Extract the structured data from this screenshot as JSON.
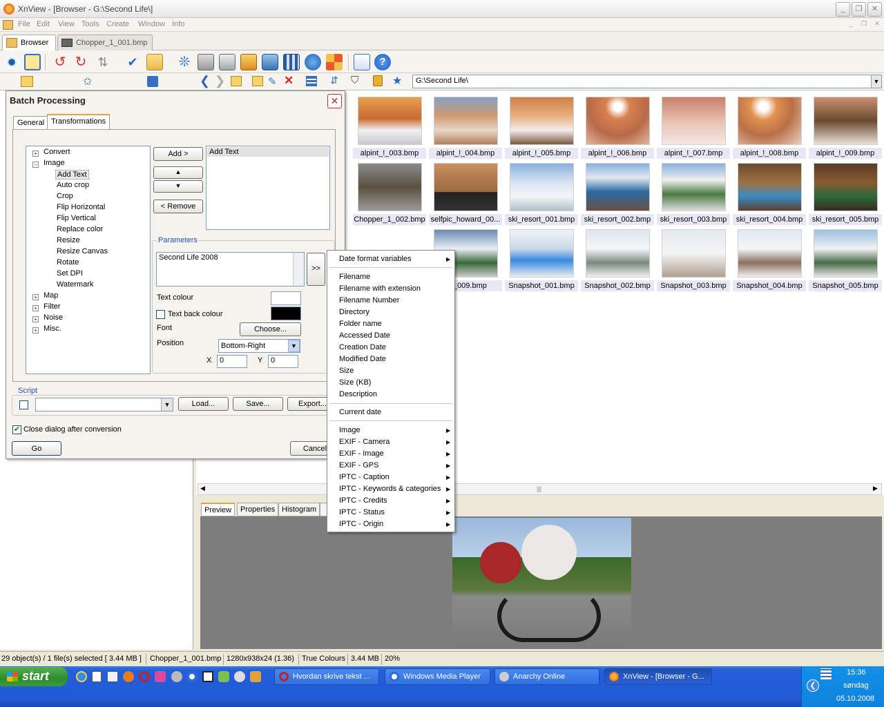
{
  "window": {
    "title": "XnView - [Browser - G:\\Second Life\\]"
  },
  "menu": [
    "File",
    "Edit",
    "View",
    "Tools",
    "Create",
    "Window",
    "Info"
  ],
  "tabs": {
    "browser": "Browser",
    "file": "Chopper_1_001.bmp"
  },
  "address": "G:\\Second Life\\",
  "thumbnails": [
    "alpint_!_003.bmp",
    "alpint_!_004.bmp",
    "alpint_!_005.bmp",
    "alpint_!_006.bmp",
    "alpint_!_007.bmp",
    "alpint_!_008.bmp",
    "alpint_!_009.bmp",
    "Chopper_1_002.bmp",
    "selfpic_howard_00...",
    "ski_resort_001.bmp",
    "ski_resort_002.bmp",
    "ski_resort_003.bmp",
    "ski_resort_004.bmp",
    "ski_resort_005.bmp",
    "ort_009.bmp",
    "Snapshot_001.bmp",
    "Snapshot_002.bmp",
    "Snapshot_003.bmp",
    "Snapshot_004.bmp",
    "Snapshot_005.bmp"
  ],
  "preview_tabs": [
    "Preview",
    "Properties",
    "Histogram"
  ],
  "status": {
    "objects": "29 object(s) / 1 file(s) selected  [ 3.44 MB ]",
    "file": "Chopper_1_001.bmp",
    "dims": "1280x938x24 (1.36)",
    "colours": "True Colours",
    "size": "3.44 MB",
    "zoom": "20%"
  },
  "dialog": {
    "title": "Batch Processing",
    "tabs": {
      "general": "General",
      "transformations": "Transformations"
    },
    "tree": {
      "convert": "Convert",
      "image": "Image",
      "image_children": [
        "Add Text",
        "Auto crop",
        "Crop",
        "Flip Horizontal",
        "Flip Vertical",
        "Replace color",
        "Resize",
        "Resize Canvas",
        "Rotate",
        "Set DPI",
        "Watermark"
      ],
      "map": "Map",
      "filter": "Filter",
      "noise": "Noise",
      "misc": "Misc."
    },
    "add_button": "Add >",
    "remove_button": "< Remove",
    "up_arrow": "▲",
    "down_arrow": "▼",
    "list_items": [
      "Add Text"
    ],
    "parameters_label": "Parameters",
    "text_value": "Second Life 2008",
    "insert_button": ">>",
    "text_colour_label": "Text colour",
    "text_back_colour_label": "Text back colour",
    "font_label": "Font",
    "choose_button": "Choose...",
    "position_label": "Position",
    "position_value": "Bottom-Right",
    "x_label": "X",
    "x_value": "0",
    "y_label": "Y",
    "y_value": "0",
    "script_label": "Script",
    "load_button": "Load...",
    "save_button": "Save...",
    "export_button": "Export...",
    "close_after": "Close dialog after conversion",
    "go_button": "Go",
    "cancel_button": "Cancel"
  },
  "context_menu": {
    "date_format": "Date format variables",
    "group1": [
      "Filename",
      "Filename with extension",
      "Filename Number",
      "Directory",
      "Folder name",
      "Accessed Date",
      "Creation Date",
      "Modified Date",
      "Size",
      "Size (KB)",
      "Description"
    ],
    "current_date": "Current date",
    "group3": [
      "Image",
      "EXIF - Camera",
      "EXIF - Image",
      "EXIF - GPS",
      "IPTC - Caption",
      "IPTC - Keywords & categories",
      "IPTC - Credits",
      "IPTC - Status",
      "IPTC - Origin"
    ]
  },
  "taskbar": {
    "start": "start",
    "buttons": [
      "Hvordan skrive tekst ...",
      "Windows Media Player",
      "Anarchy Online",
      "XnView - [Browser - G..."
    ],
    "clock": "15:36",
    "day": "søndag",
    "date": "05.10.2008"
  },
  "colors": {
    "accent_orange": "#e8a33a",
    "taskbar_blue": "#245edb",
    "start_green": "#3c9a3c",
    "label_blue": "#2b4fb8"
  }
}
